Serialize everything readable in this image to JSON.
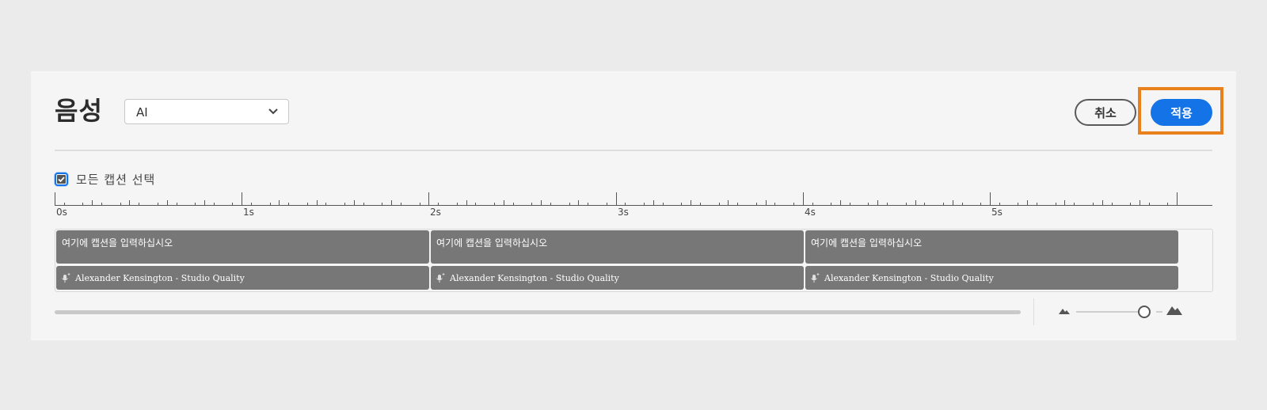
{
  "header": {
    "title": "음성",
    "voice_select": {
      "value": "AI"
    },
    "cancel_label": "취소",
    "apply_label": "적용"
  },
  "select_all": {
    "label": "모든 캡션 선택",
    "checked": true
  },
  "ruler": {
    "labels": [
      "0s",
      "1s",
      "2s",
      "3s",
      "4s",
      "5s"
    ]
  },
  "captions": [
    {
      "text": "여기에 캡션을 입력하십시오",
      "voice": "Alexander Kensington - Studio Quality"
    },
    {
      "text": "여기에 캡션을 입력하십시오",
      "voice": "Alexander Kensington - Studio Quality"
    },
    {
      "text": "여기에 캡션을 입력하십시오",
      "voice": "Alexander Kensington - Studio Quality"
    }
  ],
  "icons": {
    "dropdown": "chevron-down-icon",
    "checkbox": "checkmark-icon",
    "voice": "microphone-sparkle-icon",
    "zoom_out": "mountain-small-icon",
    "zoom_in": "mountain-large-icon"
  },
  "zoom": {
    "level": 0.87
  },
  "colors": {
    "accent": "#1473e6",
    "highlight": "#e8801c",
    "clip": "#777777"
  }
}
